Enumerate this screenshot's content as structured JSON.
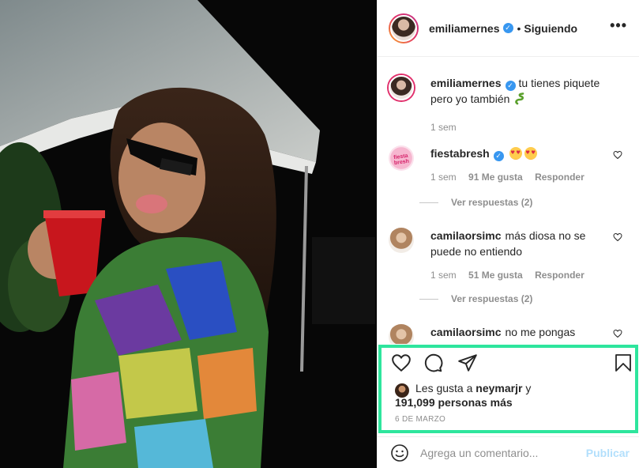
{
  "post": {
    "username": "emiliamernes",
    "follow_status": "Siguiendo",
    "separator": "•",
    "more_label": "•••"
  },
  "caption": {
    "username": "emiliamernes",
    "text": "tu tienes piquete pero yo también",
    "time": "1 sem"
  },
  "comments": [
    {
      "username": "fiestabresh",
      "avatar_text": "fiesta bresh",
      "text": "",
      "time": "1 sem",
      "likes": "91 Me gusta",
      "reply": "Responder",
      "view_replies": "Ver respuestas (2)"
    },
    {
      "username": "camilaorsimc",
      "text": "más diosa no se puede no entiendo",
      "time": "1 sem",
      "likes": "51 Me gusta",
      "reply": "Responder",
      "view_replies": "Ver respuestas (2)"
    },
    {
      "username": "camilaorsimc",
      "text": "no me pongas"
    }
  ],
  "likes": {
    "prefix": "Les gusta a",
    "user": "neymarjr",
    "connector": "y",
    "count": "191,099 personas más"
  },
  "date": "6 DE MARZO",
  "add_comment": {
    "placeholder": "Agrega un comentario...",
    "publish_label": "Publicar"
  },
  "icons": [
    "heart-icon",
    "comment-icon",
    "share-icon",
    "bookmark-icon",
    "emoji-icon",
    "verified-icon"
  ],
  "colors": {
    "highlight": "#2ee59d",
    "verified": "#3897f0",
    "publish_disabled": "#b2dffc"
  }
}
